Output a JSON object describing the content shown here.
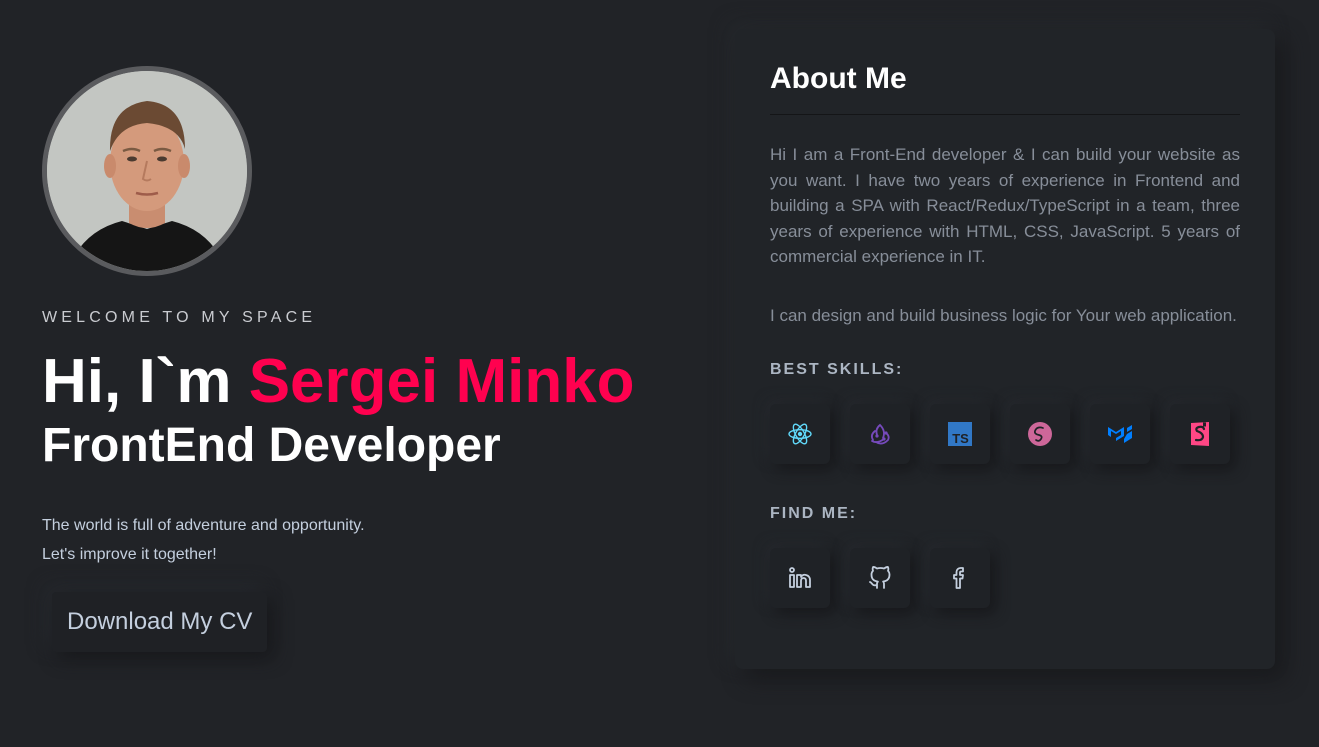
{
  "hero": {
    "welcome": "WELCOME TO MY SPACE",
    "greeting": "Hi, I`m ",
    "name": "Sergei Minko",
    "role": "FrontEnd Developer",
    "description_line1": "The world is full of adventure and opportunity.",
    "description_line2": "Let's improve it together!",
    "cv_button": "Download My CV"
  },
  "about": {
    "title": "About Me",
    "paragraph1": "Hi I am a Front-End developer & I can build your website as you want. I have two years of experience in Frontend and building a SPA with React/Redux/TypeScript in a team, three years of experience with HTML, CSS, JavaScript. 5 years of commercial experience in IT.",
    "paragraph2": "I can design and build business logic for Your web application.",
    "skills_label": "BEST SKILLS:",
    "find_label": "FIND ME:"
  },
  "skills": [
    {
      "icon": "react-icon",
      "color": "#61dafb"
    },
    {
      "icon": "redux-icon",
      "color": "#764abc"
    },
    {
      "icon": "typescript-icon",
      "color": "#3178c6"
    },
    {
      "icon": "sass-icon",
      "color": "#cd6799"
    },
    {
      "icon": "material-ui-icon",
      "color": "#007fff"
    },
    {
      "icon": "styled-components-icon",
      "color": "#ff5c8d"
    }
  ],
  "social": [
    {
      "icon": "linkedin-icon"
    },
    {
      "icon": "github-icon"
    },
    {
      "icon": "facebook-icon"
    }
  ],
  "colors": {
    "accent": "#ff014f",
    "background": "#212327",
    "text_muted": "#878e99"
  }
}
